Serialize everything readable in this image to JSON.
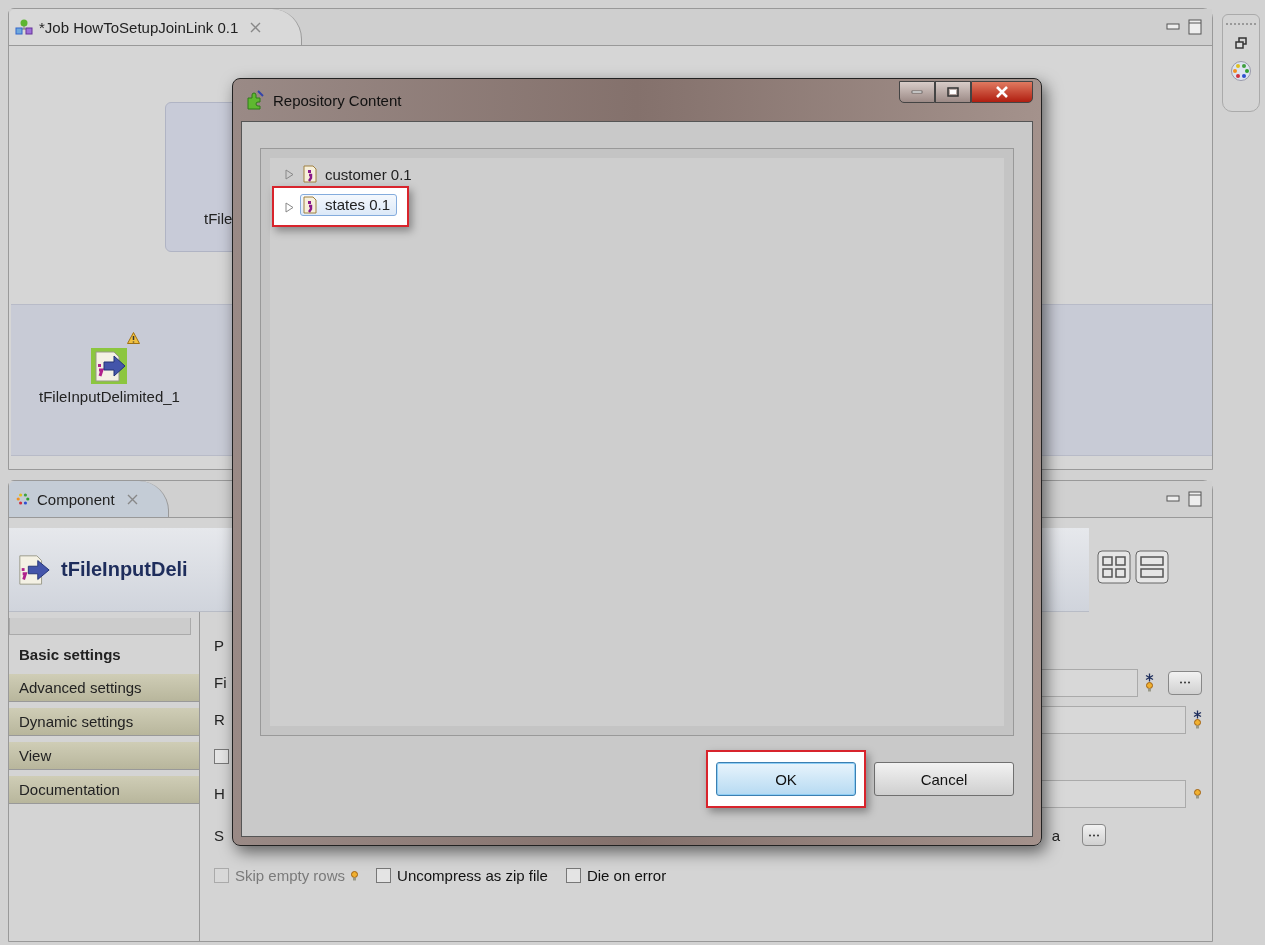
{
  "editor": {
    "tab_title": "*Job HowToSetupJoinLink 0.1",
    "nodes": [
      {
        "label": "tFile",
        "warning": false
      },
      {
        "label": "tFileInputDelimited_1",
        "warning": true
      }
    ]
  },
  "component_panel": {
    "tab_title": "Component",
    "component_name": "tFileInputDeli",
    "side_tabs": [
      {
        "label": "Basic settings",
        "selected": true
      },
      {
        "label": "Advanced settings",
        "selected": false
      },
      {
        "label": "Dynamic settings",
        "selected": false
      },
      {
        "label": "View",
        "selected": false
      },
      {
        "label": "Documentation",
        "selected": false
      }
    ],
    "rows": [
      {
        "kind": "text",
        "label": "P"
      },
      {
        "kind": "field",
        "label": "Fi",
        "required": true,
        "browse": true
      },
      {
        "kind": "field",
        "label": "R",
        "required": true,
        "browse": false
      },
      {
        "kind": "checkbox",
        "checked": false
      },
      {
        "kind": "field",
        "label": "H",
        "required": false,
        "browse": false
      },
      {
        "kind": "browse",
        "label": "S",
        "tail": "a"
      }
    ],
    "options": [
      {
        "label": "Skip empty rows",
        "checked": false,
        "disabled": true,
        "hint": true
      },
      {
        "label": "Uncompress as zip file",
        "checked": false,
        "disabled": false,
        "hint": false
      },
      {
        "label": "Die on error",
        "checked": false,
        "disabled": false,
        "hint": false
      }
    ]
  },
  "dialog": {
    "title": "Repository Content",
    "tree": [
      {
        "label": "customer 0.1",
        "selected": false,
        "expanded": false,
        "highlighted": false
      },
      {
        "label": "states 0.1",
        "selected": true,
        "expanded": false,
        "highlighted": true
      }
    ],
    "buttons": [
      {
        "label": "OK",
        "default": true,
        "highlighted": true
      },
      {
        "label": "Cancel",
        "default": false,
        "highlighted": false
      }
    ]
  }
}
